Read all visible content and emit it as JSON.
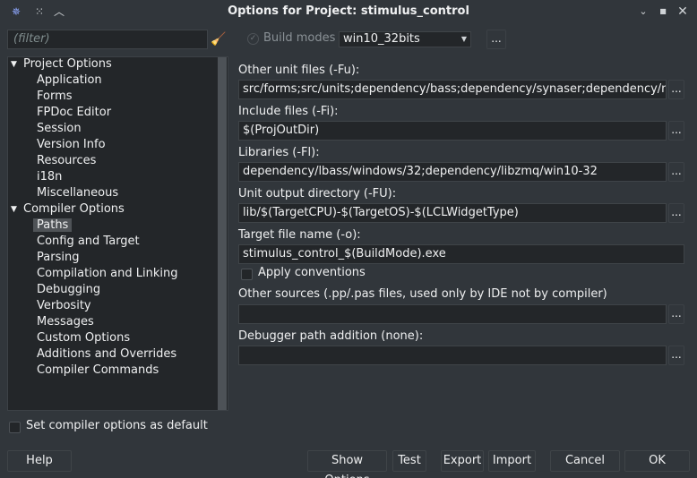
{
  "window": {
    "title": "Options for Project: stimulus_control",
    "title_icons": [
      "app-icon",
      "pin-icon",
      "collapse-icon"
    ],
    "controls": [
      "minimize",
      "maximize",
      "close"
    ]
  },
  "filter": {
    "placeholder": "(filter)"
  },
  "tree": {
    "groups": [
      {
        "label": "Project Options",
        "items": [
          "Application",
          "Forms",
          "FPDoc Editor",
          "Session",
          "Version Info",
          "Resources",
          "i18n",
          "Miscellaneous"
        ]
      },
      {
        "label": "Compiler Options",
        "items": [
          "Paths",
          "Config and Target",
          "Parsing",
          "Compilation and Linking",
          "Debugging",
          "Verbosity",
          "Messages",
          "Custom Options",
          "Additions and Overrides",
          "Compiler Commands"
        ]
      }
    ],
    "selected": "Paths"
  },
  "set_default": {
    "label": "Set compiler options as default",
    "checked": false
  },
  "build_modes": {
    "label": "Build modes",
    "value": "win10_32bits",
    "more": "..."
  },
  "fields": {
    "other_unit": {
      "label": "Other unit files (-Fu):",
      "value": "src/forms;src/units;dependency/bass;dependency/synaser;dependency/msgpac",
      "more": "..."
    },
    "include": {
      "label": "Include files (-Fi):",
      "value": "$(ProjOutDir)",
      "more": "..."
    },
    "libraries": {
      "label": "Libraries (-Fl):",
      "value": "dependency/lbass/windows/32;dependency/libzmq/win10-32",
      "more": "..."
    },
    "unit_output": {
      "label": "Unit output directory (-FU):",
      "value": "lib/$(TargetCPU)-$(TargetOS)-$(LCLWidgetType)",
      "more": "..."
    },
    "target_file": {
      "label": "Target file name (-o):",
      "value": "stimulus_control_$(BuildMode).exe"
    },
    "other_sources": {
      "label": "Other sources (.pp/.pas files, used only by IDE not by compiler)",
      "value": "",
      "more": "..."
    },
    "debugger_path": {
      "label": "Debugger path addition (none):",
      "value": "",
      "more": "..."
    }
  },
  "apply_conventions": {
    "label": "Apply conventions",
    "checked": false
  },
  "buttons": {
    "help": "Help",
    "show_options": "Show Options",
    "test": "Test",
    "export": "Export",
    "import": "Import",
    "cancel": "Cancel",
    "ok": "OK"
  }
}
